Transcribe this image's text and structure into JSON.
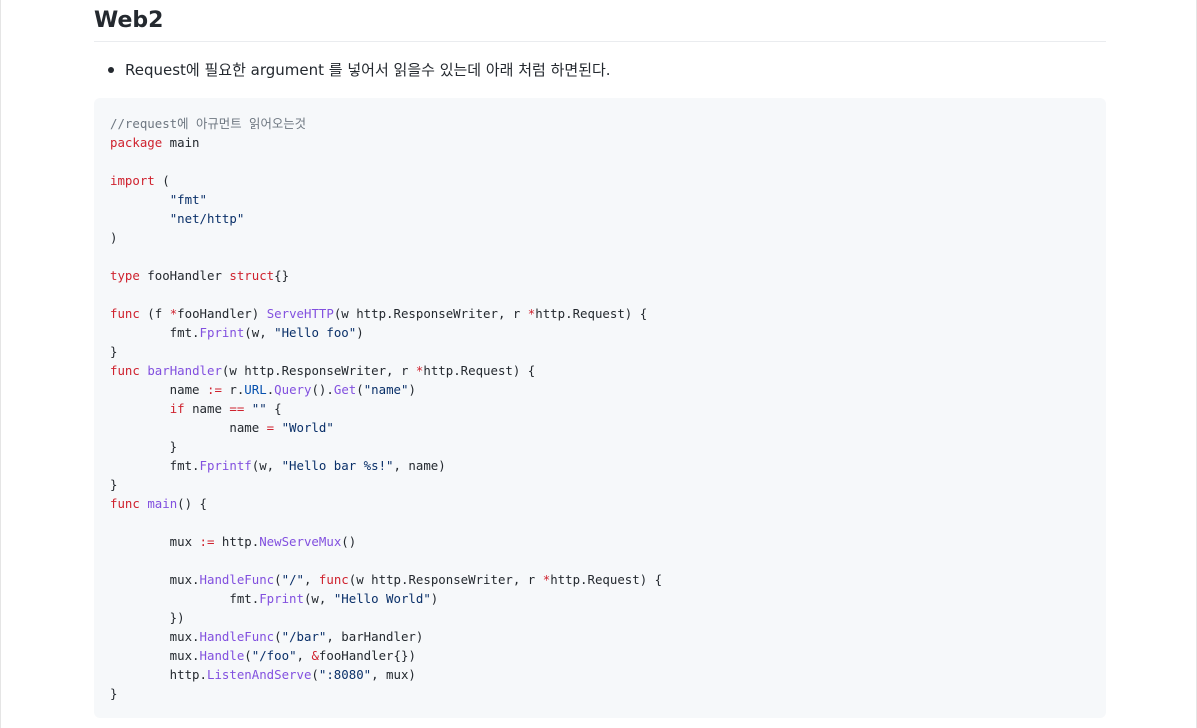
{
  "heading": "Web2",
  "bullet": "Request에 필요한 argument 를 넣어서 읽을수 있는데 아래 처럼 하면된다.",
  "code_lines": [
    [
      {
        "t": "//request에 아규먼트 읽어오는것",
        "c": "c"
      }
    ],
    [
      {
        "t": "package",
        "c": "k"
      },
      {
        "t": " main"
      }
    ],
    [],
    [
      {
        "t": "import",
        "c": "k"
      },
      {
        "t": " ("
      }
    ],
    [
      {
        "t": "        "
      },
      {
        "t": "\"fmt\"",
        "c": "s"
      }
    ],
    [
      {
        "t": "        "
      },
      {
        "t": "\"net/http\"",
        "c": "s"
      }
    ],
    [
      {
        "t": ")"
      }
    ],
    [],
    [
      {
        "t": "type",
        "c": "k"
      },
      {
        "t": " fooHandler "
      },
      {
        "t": "struct",
        "c": "k"
      },
      {
        "t": "{}"
      }
    ],
    [],
    [
      {
        "t": "func",
        "c": "k"
      },
      {
        "t": " (f "
      },
      {
        "t": "*",
        "c": "k"
      },
      {
        "t": "fooHandler) "
      },
      {
        "t": "ServeHTTP",
        "c": "f"
      },
      {
        "t": "(w http.ResponseWriter, r "
      },
      {
        "t": "*",
        "c": "k"
      },
      {
        "t": "http.Request) {"
      }
    ],
    [
      {
        "t": "        fmt."
      },
      {
        "t": "Fprint",
        "c": "f"
      },
      {
        "t": "(w, "
      },
      {
        "t": "\"Hello foo\"",
        "c": "s"
      },
      {
        "t": ")"
      }
    ],
    [
      {
        "t": "}"
      }
    ],
    [
      {
        "t": "func",
        "c": "k"
      },
      {
        "t": " "
      },
      {
        "t": "barHandler",
        "c": "f"
      },
      {
        "t": "(w http.ResponseWriter, r "
      },
      {
        "t": "*",
        "c": "k"
      },
      {
        "t": "http.Request) {"
      }
    ],
    [
      {
        "t": "        name "
      },
      {
        "t": ":=",
        "c": "k"
      },
      {
        "t": " r."
      },
      {
        "t": "URL",
        "c": "p"
      },
      {
        "t": "."
      },
      {
        "t": "Query",
        "c": "f"
      },
      {
        "t": "()."
      },
      {
        "t": "Get",
        "c": "f"
      },
      {
        "t": "("
      },
      {
        "t": "\"name\"",
        "c": "s"
      },
      {
        "t": ")"
      }
    ],
    [
      {
        "t": "        "
      },
      {
        "t": "if",
        "c": "k"
      },
      {
        "t": " name "
      },
      {
        "t": "==",
        "c": "k"
      },
      {
        "t": " "
      },
      {
        "t": "\"\"",
        "c": "s"
      },
      {
        "t": " {"
      }
    ],
    [
      {
        "t": "                name "
      },
      {
        "t": "=",
        "c": "k"
      },
      {
        "t": " "
      },
      {
        "t": "\"World\"",
        "c": "s"
      }
    ],
    [
      {
        "t": "        }"
      }
    ],
    [
      {
        "t": "        fmt."
      },
      {
        "t": "Fprintf",
        "c": "f"
      },
      {
        "t": "(w, "
      },
      {
        "t": "\"Hello bar %s!\"",
        "c": "s"
      },
      {
        "t": ", name)"
      }
    ],
    [
      {
        "t": "}"
      }
    ],
    [
      {
        "t": "func",
        "c": "k"
      },
      {
        "t": " "
      },
      {
        "t": "main",
        "c": "f"
      },
      {
        "t": "() {"
      }
    ],
    [],
    [
      {
        "t": "        mux "
      },
      {
        "t": ":=",
        "c": "k"
      },
      {
        "t": " http."
      },
      {
        "t": "NewServeMux",
        "c": "f"
      },
      {
        "t": "()"
      }
    ],
    [],
    [
      {
        "t": "        mux."
      },
      {
        "t": "HandleFunc",
        "c": "f"
      },
      {
        "t": "("
      },
      {
        "t": "\"/\"",
        "c": "s"
      },
      {
        "t": ", "
      },
      {
        "t": "func",
        "c": "k"
      },
      {
        "t": "(w http.ResponseWriter, r "
      },
      {
        "t": "*",
        "c": "k"
      },
      {
        "t": "http.Request) {"
      }
    ],
    [
      {
        "t": "                fmt."
      },
      {
        "t": "Fprint",
        "c": "f"
      },
      {
        "t": "(w, "
      },
      {
        "t": "\"Hello World\"",
        "c": "s"
      },
      {
        "t": ")"
      }
    ],
    [
      {
        "t": "        })"
      }
    ],
    [
      {
        "t": "        mux."
      },
      {
        "t": "HandleFunc",
        "c": "f"
      },
      {
        "t": "("
      },
      {
        "t": "\"/bar\"",
        "c": "s"
      },
      {
        "t": ", barHandler)"
      }
    ],
    [
      {
        "t": "        mux."
      },
      {
        "t": "Handle",
        "c": "f"
      },
      {
        "t": "("
      },
      {
        "t": "\"/foo\"",
        "c": "s"
      },
      {
        "t": ", "
      },
      {
        "t": "&",
        "c": "k"
      },
      {
        "t": "fooHandler{})"
      }
    ],
    [
      {
        "t": "        http."
      },
      {
        "t": "ListenAndServe",
        "c": "f"
      },
      {
        "t": "("
      },
      {
        "t": "\":8080\"",
        "c": "s"
      },
      {
        "t": ", mux)"
      }
    ],
    [
      {
        "t": "}"
      }
    ]
  ]
}
